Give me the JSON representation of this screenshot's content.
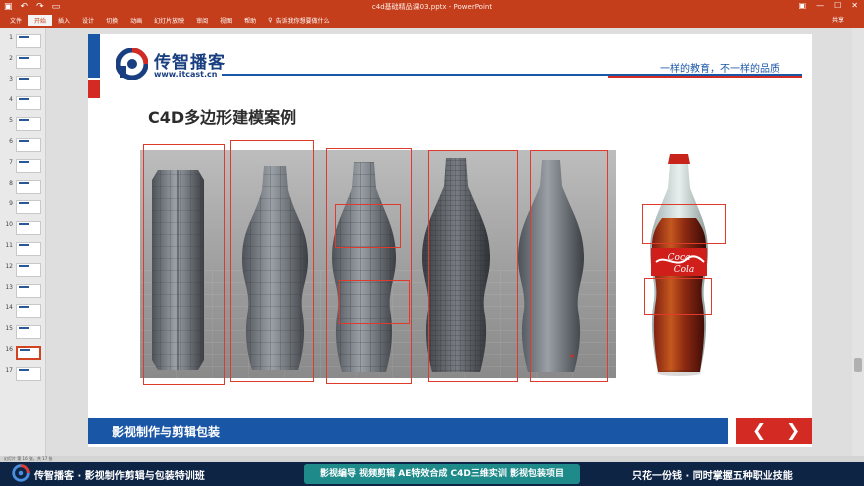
{
  "window": {
    "doc_title": "c4d基础精品课03.pptx - PowerPoint",
    "ribbon_tabs": [
      "文件",
      "开始",
      "插入",
      "设计",
      "切换",
      "动画",
      "幻灯片放映",
      "审阅",
      "视图",
      "帮助"
    ],
    "active_tab_index": 1,
    "tell_me": "告诉我你想要做什么",
    "share": "共享"
  },
  "thumbnails": [
    {
      "num": "1"
    },
    {
      "num": "2"
    },
    {
      "num": "3"
    },
    {
      "num": "4"
    },
    {
      "num": "5"
    },
    {
      "num": "6"
    },
    {
      "num": "7"
    },
    {
      "num": "8"
    },
    {
      "num": "9"
    },
    {
      "num": "10"
    },
    {
      "num": "11"
    },
    {
      "num": "12"
    },
    {
      "num": "13"
    },
    {
      "num": "14"
    },
    {
      "num": "15"
    },
    {
      "num": "16"
    },
    {
      "num": "17"
    }
  ],
  "active_slide": "16",
  "slide": {
    "logo_name": "传智播客",
    "logo_url": "www.itcast.cn",
    "tagline": "一样的教育，不一样的品质",
    "title": "C4D多边形建模案例",
    "footer_text": "影视制作与剪辑包装",
    "prev_glyph": "❮",
    "next_glyph": "❯"
  },
  "status": {
    "left": "幻灯片 第 16 张，共 17 张"
  },
  "promo": {
    "left": "传智播客 · 影视制作剪辑与包装特训班",
    "center": "影视编导 视频剪辑 AE特效合成 C4D三维实训 影视包装项目",
    "right": "只花一份钱 · 同时掌握五种职业技能"
  },
  "colors": {
    "ribbon": "#c43e1c",
    "brand_blue": "#1a56a6",
    "brand_red": "#d42a24",
    "annotation_red": "#e03a2c",
    "promo_bg": "#0e2445"
  }
}
